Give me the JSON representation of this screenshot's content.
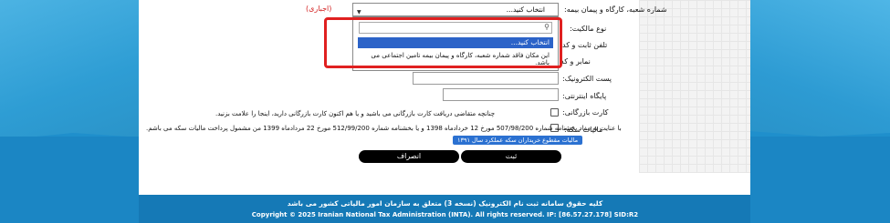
{
  "form": {
    "branch_label": "شماره شعبه، کارگاه و پیمان بیمه:",
    "branch_select_value": "انتخاب کنید...",
    "required_tag": "(اجباری)",
    "ownership_label": "نوع مالکیت:",
    "phone_label": "تلفن ثابت و کد",
    "fax_label": "نمابر و کد",
    "email_label": "پست الکترونیک:",
    "website_label": "پایگاه اینترنتی:",
    "commerce_card_label": "کارت بازرگانی:",
    "coin_tax_label": "مالیات سکه:",
    "commerce_card_note": "چنانچه متقاضی دریافت کارت بازرگانی می باشید و یا هم اکنون کارت بازرگانی دارید، اینجا را علامت بزنید.",
    "coin_tax_note": "با عنایت به مفاد بخشنامه شماره 507/98/200 مورخ 12 خردادماه 1398 و یا بخشنامه شماره 512/99/200 مورخ 22 مردادماه 1399 من مشمول پرداخت مالیات سکه می باشم.",
    "coin_tax_badge": "مالیات مقطوع خریداران سکه عملکرد سال ۱۳۹۱"
  },
  "dropdown": {
    "search_placeholder": "",
    "selected_option": "انتخاب کنید...",
    "message": "این مکان فاقد شماره شعبه، کارگاه و پیمان بیمه تامین اجتماعی می باشد."
  },
  "buttons": {
    "submit": "ثبت",
    "cancel": "انصراف"
  },
  "footer": {
    "rights_fa": "کلیه حقوق سامانه ثبت نام الکترونیک (نسخه 3) متعلق به سازمان امور مالیاتی کشور می باشد",
    "copyright": "Copyright © 2025 Iranian National Tax Administration (INTA). All rights reserved. IP: [86.57.27.178] SID:R2"
  },
  "colors": {
    "accent": "#2c63c8",
    "required": "#d21e1e",
    "highlight": "#e02020",
    "background": "#2ea0d6"
  }
}
